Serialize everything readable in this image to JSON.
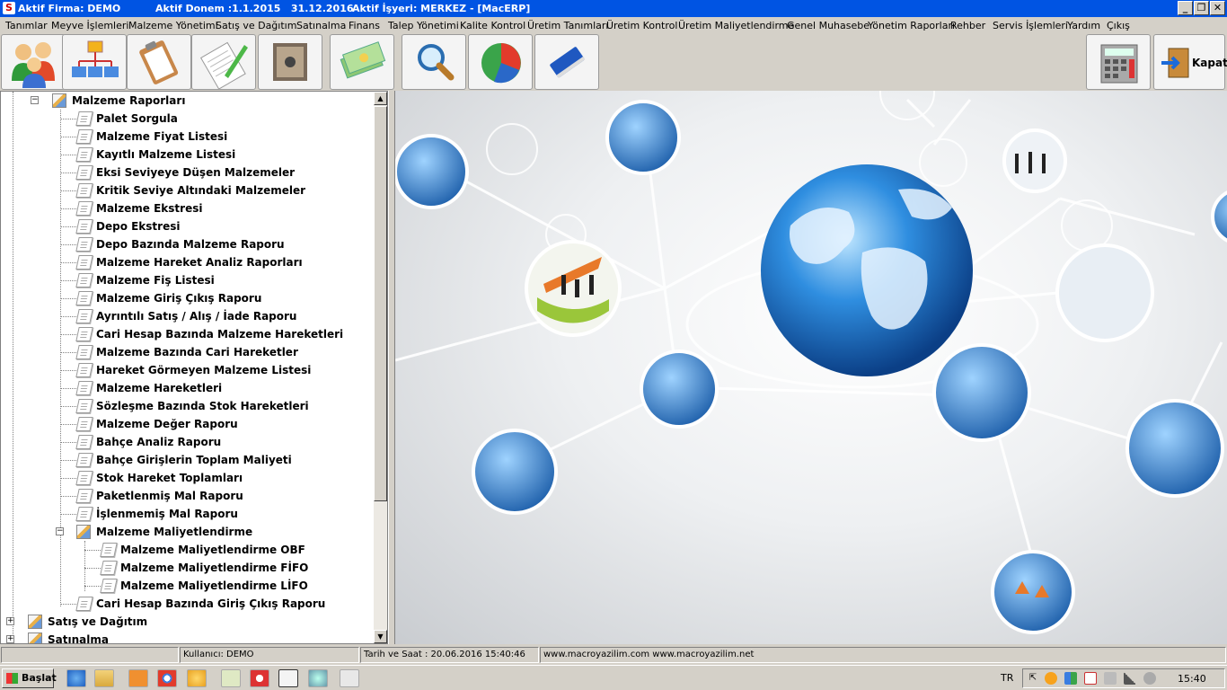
{
  "titlebar": {
    "firma": "Aktif Firma: DEMO",
    "donem": "Aktif Donem :1.1.2015   31.12.2016",
    "isyeri": "Aktif İşyeri: MERKEZ - [MacERP]",
    "icon_letter": "S",
    "minimize": "_",
    "restore": "❐",
    "close": "✕"
  },
  "menu": [
    "Tanımlar",
    "Meyve İşlemleri",
    "Malzeme Yönetimi",
    "Satış ve Dağıtım",
    "Satınalma",
    "Finans",
    "Talep Yönetimi",
    "Kalite Kontrol",
    "Üretim Tanımları",
    "Üretim Kontrol",
    "Üretim Maliyetlendirme",
    "Genel Muhasebe",
    "Yönetim Raporları",
    "Rehber",
    "Servis İşlemleri",
    "Yardım",
    "Çıkış"
  ],
  "toolbar": {
    "icons": [
      "users-icon",
      "org-chart-icon",
      "clipboard-icon",
      "notepad-pen-icon",
      "safe-icon",
      "money-icon",
      "magnifier-icon",
      "pie-chart-icon",
      "book-icon",
      "calculator-icon"
    ],
    "kapat_label": "Kapat"
  },
  "tree": {
    "root_label": "Malzeme Raporları",
    "items": [
      "Palet Sorgula",
      "Malzeme Fiyat Listesi",
      "Kayıtlı Malzeme  Listesi",
      "Eksi Seviyeye Düşen Malzemeler",
      "Kritik Seviye Altındaki Malzemeler",
      "Malzeme Ekstresi",
      "Depo Ekstresi",
      "Depo Bazında Malzeme  Raporu",
      "Malzeme  Hareket Analiz Raporları",
      "Malzeme Fiş Listesi",
      "Malzeme  Giriş Çıkış Raporu",
      "Ayrıntılı Satış / Alış /  İade Raporu",
      "Cari Hesap Bazında Malzeme  Hareketleri",
      "Malzeme  Bazında Cari Hareketler",
      "Hareket Görmeyen Malzeme Listesi",
      "Malzeme Hareketleri",
      "Sözleşme Bazında Stok Hareketleri",
      "Malzeme  Değer Raporu",
      "Bahçe Analiz Raporu",
      "Bahçe Girişlerin Toplam Maliyeti",
      "Stok Hareket Toplamları",
      "Paketlenmiş  Mal Raporu",
      "İşlenmemiş Mal Raporu"
    ],
    "sub_label": "Malzeme Maliyetlendirme",
    "sub_items": [
      "Malzeme Maliyetlendirme OBF",
      "Malzeme Maliyetlendirme FİFO",
      "Malzeme Maliyetlendirme LİFO"
    ],
    "after_item": "Cari Hesap Bazında Giriş Çıkış Raporu",
    "bottom_nodes": [
      "Satış ve Dağıtım",
      "Satınalma"
    ],
    "expander_minus": "−",
    "expander_plus": "+"
  },
  "statusbar": {
    "kullanici": "Kullanıcı: DEMO",
    "tarih": "Tarih ve Saat : 20.06.2016 15:40:46",
    "web": "www.macroyazilim.com  www.macroyazilim.net"
  },
  "taskbar": {
    "start_label": "Başlat",
    "lang": "TR",
    "clock": "15:40"
  },
  "colors": {
    "titlebar": "#0054e3",
    "window_face": "#d4d0c8",
    "globe": "#1e6fd0",
    "orange_arrow": "#e8792a"
  }
}
